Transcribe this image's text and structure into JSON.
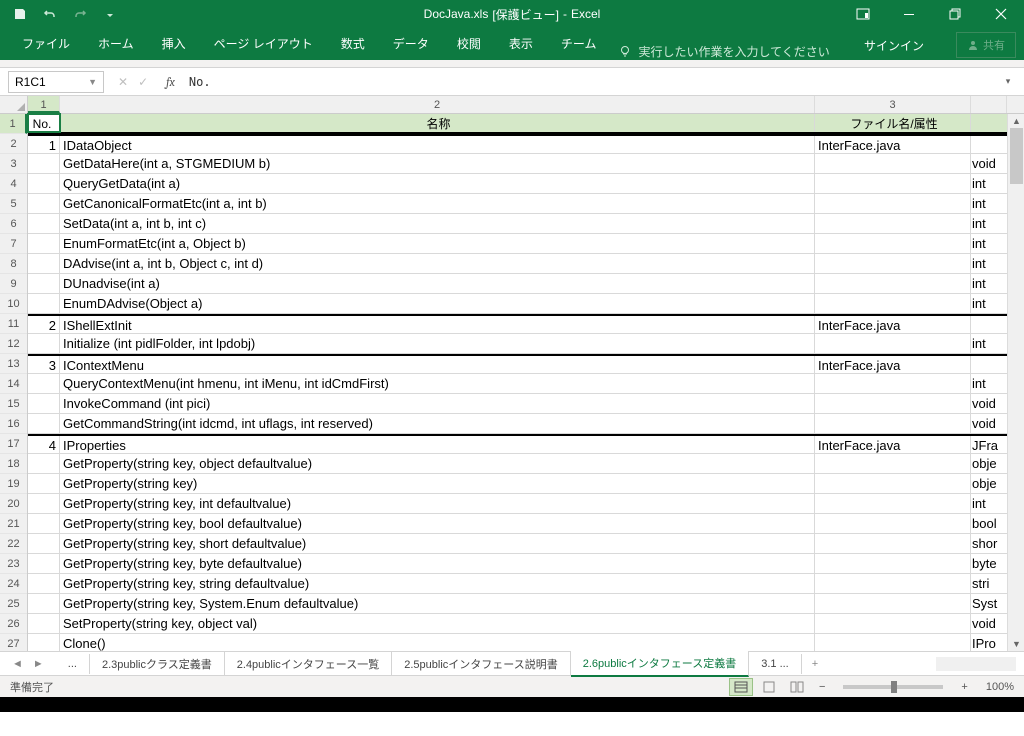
{
  "title": {
    "filename": "DocJava.xls",
    "mode": "[保護ビュー]",
    "app": "Excel"
  },
  "qat": {
    "save": "save",
    "undo": "undo",
    "redo": "redo",
    "customize": "qat-customize"
  },
  "win": {
    "ribbonopts": "ribbon-display-options",
    "min": "minimize",
    "max": "restore",
    "close": "close"
  },
  "tabs": {
    "file": "ファイル",
    "home": "ホーム",
    "insert": "挿入",
    "pagelayout": "ページ レイアウト",
    "formulas": "数式",
    "data": "データ",
    "review": "校閲",
    "view": "表示",
    "team": "チーム"
  },
  "tellme": "実行したい作業を入力してください",
  "signin": "サインイン",
  "share": "共有",
  "namebox": "R1C1",
  "fx": "fx",
  "formula_value": "No.",
  "colnums": {
    "c1": "1",
    "c2": "2",
    "c3": "3"
  },
  "headers": {
    "no": "No.",
    "name": "名称",
    "file": "ファイル名/属性"
  },
  "rows": [
    {
      "n": "1",
      "name": "IDataObject",
      "file": "InterFace.java",
      "ret": ""
    },
    {
      "n": "",
      "name": "GetDataHere(int a, STGMEDIUM b)",
      "file": "",
      "ret": "void"
    },
    {
      "n": "",
      "name": "QueryGetData(int a)",
      "file": "",
      "ret": "int"
    },
    {
      "n": "",
      "name": "GetCanonicalFormatEtc(int a, int b)",
      "file": "",
      "ret": "int"
    },
    {
      "n": "",
      "name": "SetData(int a, int b, int c)",
      "file": "",
      "ret": "int"
    },
    {
      "n": "",
      "name": "EnumFormatEtc(int a, Object b)",
      "file": "",
      "ret": "int"
    },
    {
      "n": "",
      "name": "DAdvise(int a, int b, Object c, int d)",
      "file": "",
      "ret": "int"
    },
    {
      "n": "",
      "name": "DUnadvise(int a)",
      "file": "",
      "ret": "int"
    },
    {
      "n": "",
      "name": "EnumDAdvise(Object a)",
      "file": "",
      "ret": "int"
    },
    {
      "n": "2",
      "name": "IShellExtInit",
      "file": "InterFace.java",
      "ret": ""
    },
    {
      "n": "",
      "name": "Initialize (int pidlFolder, int lpdobj)",
      "file": "",
      "ret": "int"
    },
    {
      "n": "3",
      "name": "IContextMenu",
      "file": "InterFace.java",
      "ret": ""
    },
    {
      "n": "",
      "name": "QueryContextMenu(int hmenu, int iMenu, int idCmdFirst)",
      "file": "",
      "ret": "int"
    },
    {
      "n": "",
      "name": "InvokeCommand (int pici)",
      "file": "",
      "ret": "void"
    },
    {
      "n": "",
      "name": "GetCommandString(int idcmd, int uflags, int reserved)",
      "file": "",
      "ret": "void"
    },
    {
      "n": "4",
      "name": "IProperties",
      "file": "InterFace.java",
      "ret": "JFra"
    },
    {
      "n": "",
      "name": "GetProperty(string key, object defaultvalue)",
      "file": "",
      "ret": "obje"
    },
    {
      "n": "",
      "name": "GetProperty(string key)",
      "file": "",
      "ret": "obje"
    },
    {
      "n": "",
      "name": "GetProperty(string key, int defaultvalue)",
      "file": "",
      "ret": "int"
    },
    {
      "n": "",
      "name": "GetProperty(string key, bool defaultvalue)",
      "file": "",
      "ret": "bool"
    },
    {
      "n": "",
      "name": "GetProperty(string key, short defaultvalue)",
      "file": "",
      "ret": "shor"
    },
    {
      "n": "",
      "name": "GetProperty(string key, byte defaultvalue)",
      "file": "",
      "ret": "byte"
    },
    {
      "n": "",
      "name": "GetProperty(string key, string defaultvalue)",
      "file": "",
      "ret": "stri"
    },
    {
      "n": "",
      "name": "GetProperty(string key, System.Enum defaultvalue)",
      "file": "",
      "ret": "Syst"
    },
    {
      "n": "",
      "name": "SetProperty(string key, object val)",
      "file": "",
      "ret": "void"
    },
    {
      "n": "",
      "name": "Clone()",
      "file": "",
      "ret": "IPro"
    }
  ],
  "sheets": {
    "s0": "...",
    "s1": "2.3publicクラス定義書",
    "s2": "2.4publicインタフェース一覧",
    "s3": "2.5publicインタフェース説明書",
    "s4": "2.6publicインタフェース定義書",
    "s5": "3.1 ...",
    "add": "+"
  },
  "status": {
    "ready": "準備完了",
    "zoom": "100%",
    "minus": "−",
    "plus": "+"
  }
}
